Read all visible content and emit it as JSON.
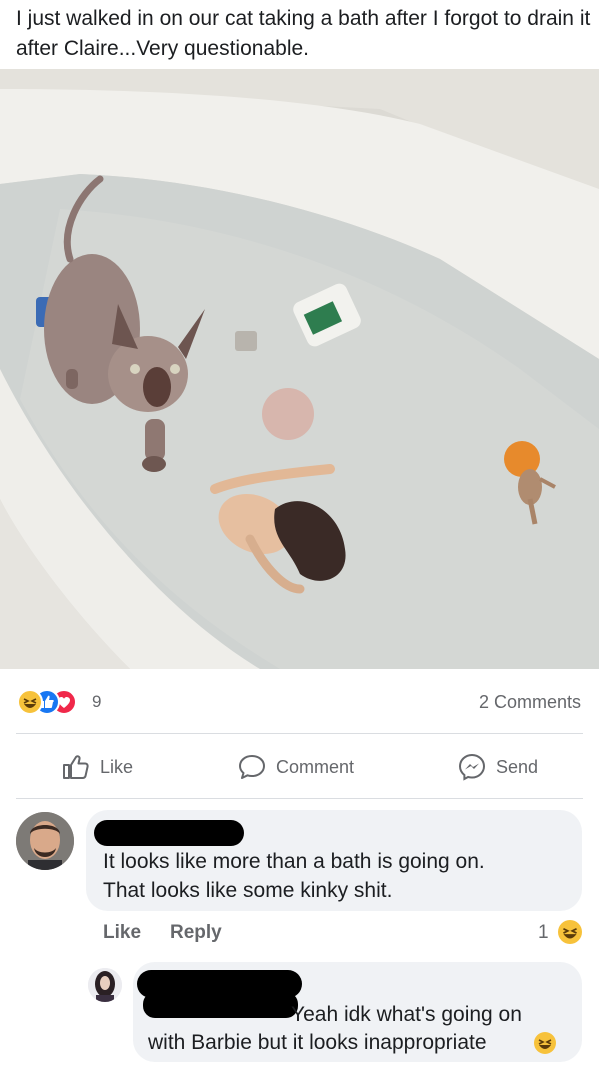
{
  "post": {
    "caption": "I just walked in on our cat taking a bath after I forgot to drain it after Claire...Very questionable."
  },
  "photo": {
    "icon": "bathtub-photo"
  },
  "stats": {
    "reaction_count": "9",
    "comments": "2 Comments"
  },
  "actions": {
    "like": "Like",
    "comment": "Comment",
    "send": "Send"
  },
  "comments": [
    {
      "text_line1": "It looks like more than a bath is going on.",
      "text_line2": "That looks like some kinky shit.",
      "like_label": "Like",
      "reply_label": "Reply",
      "reaction_count": "1"
    },
    {
      "text_line1": "Yeah idk what's going on",
      "text_line2": "with Barbie but it looks inappropriate"
    }
  ],
  "colors": {
    "accent": "#1877f2",
    "love": "#f0284a",
    "haha": "#f7c23b",
    "muted": "#65676b",
    "bubble": "#f0f2f5"
  }
}
